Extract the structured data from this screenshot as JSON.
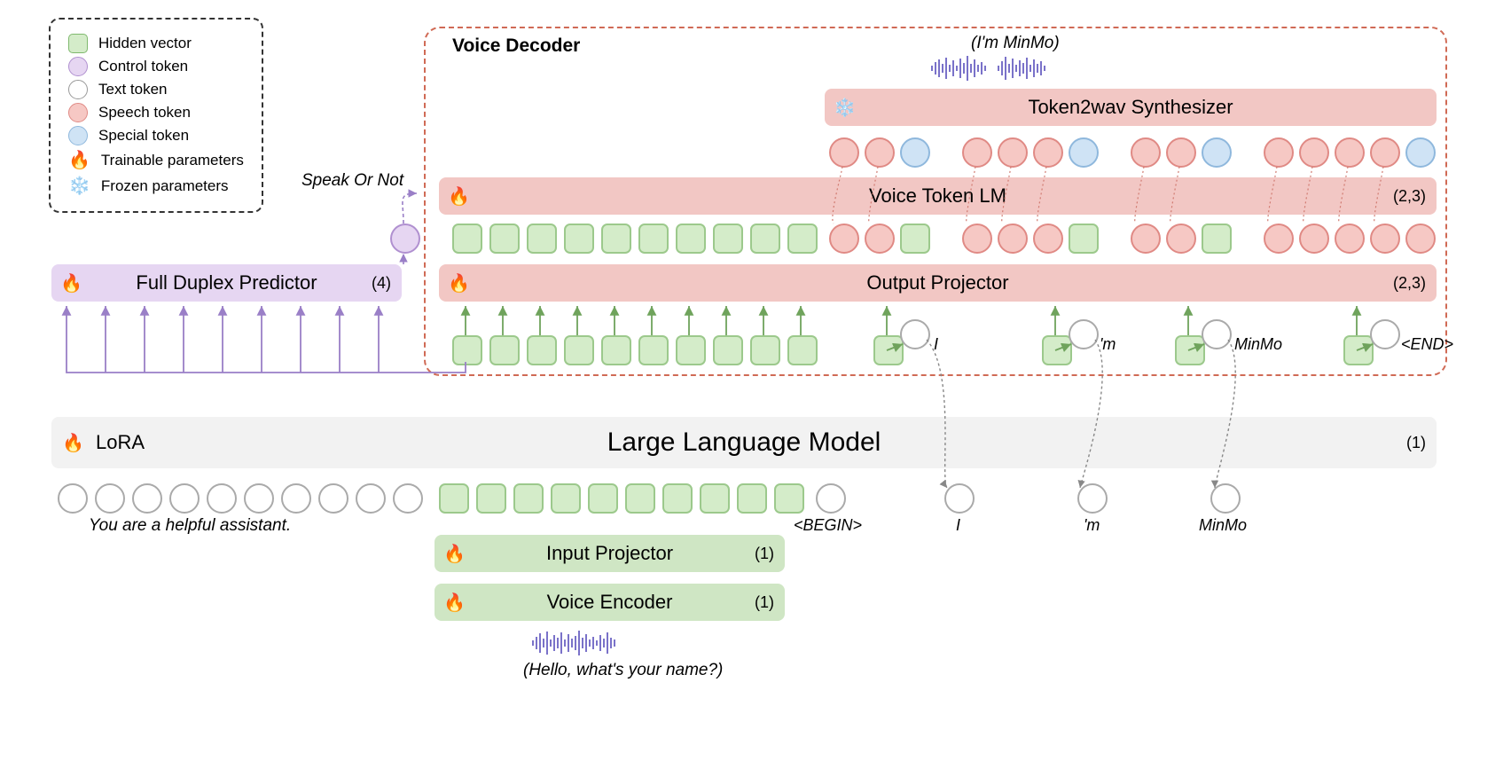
{
  "legend": {
    "hidden_vector": "Hidden vector",
    "control_token": "Control token",
    "text_token": "Text token",
    "speech_token": "Speech token",
    "special_token": "Special token",
    "trainable": "Trainable parameters",
    "frozen": "Frozen parameters"
  },
  "voice_decoder": {
    "title": "Voice Decoder",
    "token2wav": "Token2wav Synthesizer",
    "voice_token_lm": "Voice Token LM",
    "voice_token_lm_stage": "(2,3)",
    "output_projector": "Output Projector",
    "output_projector_stage": "(2,3)",
    "output_caption": "(I'm MinMo)"
  },
  "full_duplex": {
    "label": "Full Duplex Predictor",
    "stage": "(4)",
    "speak_or_not": "Speak Or Not"
  },
  "llm": {
    "lora": "LoRA",
    "label": "Large Language Model",
    "stage": "(1)"
  },
  "input": {
    "projector": "Input Projector",
    "projector_stage": "(1)",
    "encoder": "Voice Encoder",
    "encoder_stage": "(1)",
    "caption": "(Hello, what's your name?)",
    "system_prompt": "You are a helpful assistant."
  },
  "tokens": {
    "begin": "<BEGIN>",
    "I": "I",
    "m": "'m",
    "MinMo": "MinMo",
    "end": "<END>"
  }
}
